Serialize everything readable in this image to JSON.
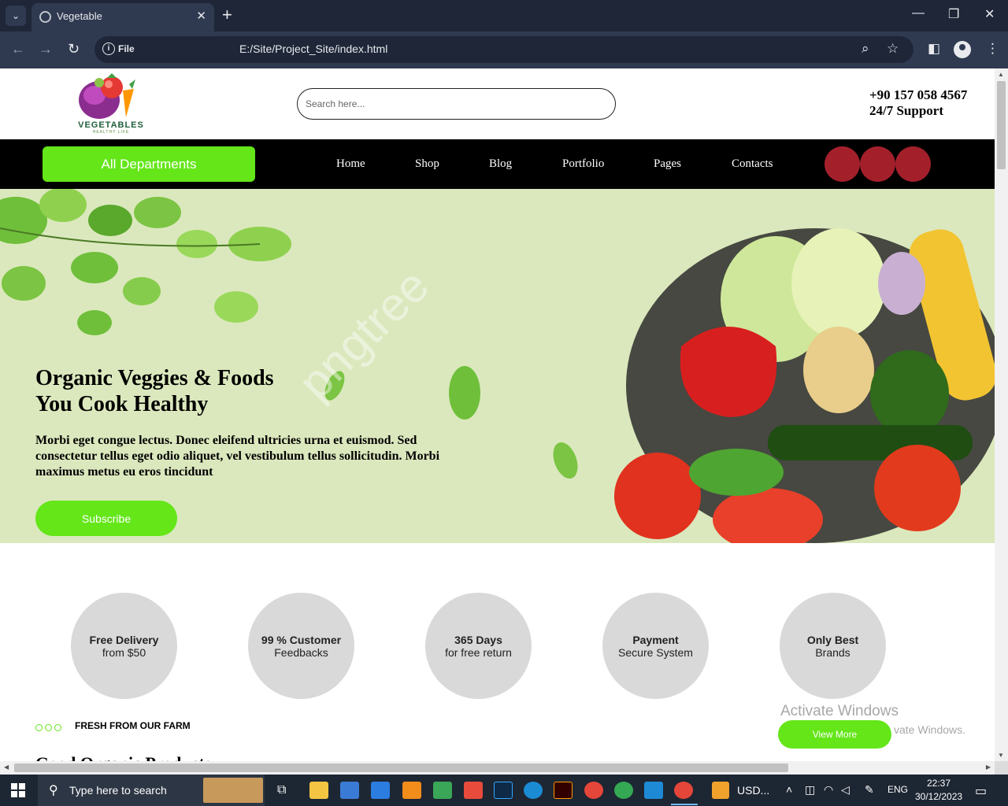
{
  "browser": {
    "tab_title": "Vegetable",
    "new_tab": "+",
    "omnibox_scheme": "File",
    "url": "E:/Site/Project_Site/index.html",
    "window_controls": [
      "—",
      "❐",
      "✕"
    ]
  },
  "site": {
    "logo_text": "VEGETABLES",
    "logo_subtext": "HEALTHY LIFE",
    "search_placeholder": "Search here...",
    "phone": "+90 157 058 4567",
    "support": "24/7 Support",
    "departments_button": "All Departments",
    "nav": [
      "Home",
      "Shop",
      "Blog",
      "Portfolio",
      "Pages",
      "Contacts"
    ],
    "social_color": "#a3202b",
    "accent_color": "#64e619"
  },
  "hero": {
    "title_line1": "Organic Veggies & Foods",
    "title_line2": "You Cook Healthy",
    "description": "Morbi eget congue lectus. Donec eleifend ultricies urna et euismod. Sed consectetur tellus eget odio aliquet, vel vestibulum tellus sollicitudin. Morbi maximus metus eu eros tincidunt",
    "subscribe_button": "Subscribe",
    "watermark": "pngtree"
  },
  "features": [
    {
      "title": "Free Delivery",
      "subtitle": "from $50"
    },
    {
      "title": "99 % Customer",
      "subtitle": "Feedbacks"
    },
    {
      "title": "365 Days",
      "subtitle": "for free return"
    },
    {
      "title": "Payment",
      "subtitle": "Secure System"
    },
    {
      "title": "Only Best",
      "subtitle": "Brands"
    }
  ],
  "farm": {
    "label": "FRESH FROM OUR FARM",
    "heading": "Good Organic Products",
    "view_more": "View More"
  },
  "activation": {
    "line1": "Activate Windows",
    "line2": "vate Windows."
  },
  "taskbar": {
    "search_placeholder": "Type here to search",
    "weather": "USD...",
    "language": "ENG",
    "time": "22:37",
    "date": "30/12/2023"
  }
}
